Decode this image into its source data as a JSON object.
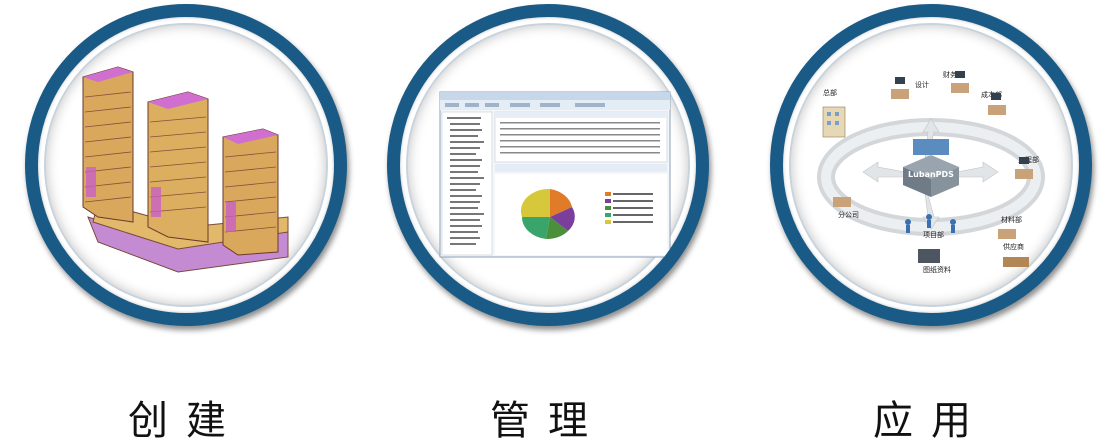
{
  "panels": [
    {
      "caption": "创建",
      "icon": "building-model-icon"
    },
    {
      "caption": "管理",
      "icon": "software-screenshot-icon"
    },
    {
      "caption": "应用",
      "icon": "network-diagram-icon"
    }
  ],
  "diagram": {
    "center": "LubanPDS",
    "nodes": [
      "设计",
      "财务部",
      "成本部",
      "总部",
      "工程部",
      "分公司",
      "材料部",
      "项目部",
      "供应商",
      "图纸资料"
    ]
  },
  "colors": {
    "ring": "#1a5a86"
  }
}
